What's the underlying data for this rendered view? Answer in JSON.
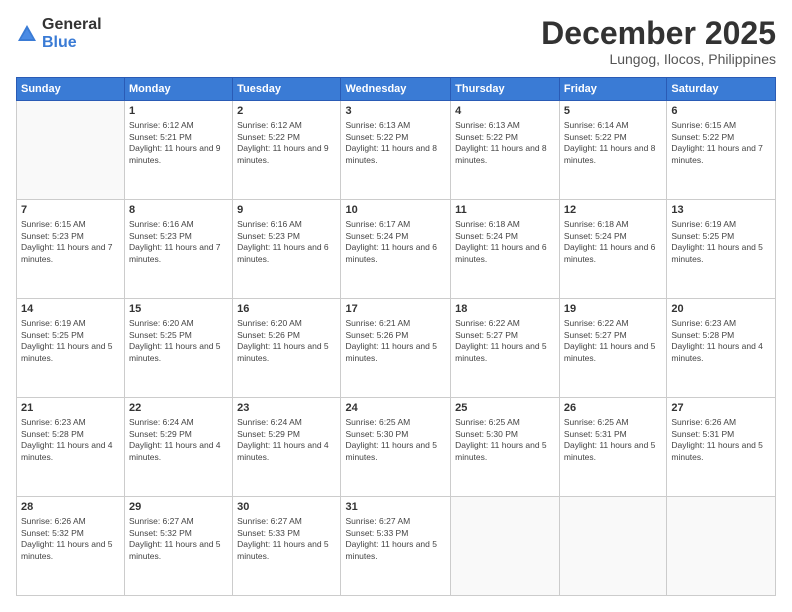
{
  "logo": {
    "general": "General",
    "blue": "Blue"
  },
  "title": "December 2025",
  "location": "Lungog, Ilocos, Philippines",
  "days_header": [
    "Sunday",
    "Monday",
    "Tuesday",
    "Wednesday",
    "Thursday",
    "Friday",
    "Saturday"
  ],
  "weeks": [
    [
      {
        "day": "",
        "sunrise": "",
        "sunset": "",
        "daylight": ""
      },
      {
        "day": "1",
        "sunrise": "Sunrise: 6:12 AM",
        "sunset": "Sunset: 5:21 PM",
        "daylight": "Daylight: 11 hours and 9 minutes."
      },
      {
        "day": "2",
        "sunrise": "Sunrise: 6:12 AM",
        "sunset": "Sunset: 5:22 PM",
        "daylight": "Daylight: 11 hours and 9 minutes."
      },
      {
        "day": "3",
        "sunrise": "Sunrise: 6:13 AM",
        "sunset": "Sunset: 5:22 PM",
        "daylight": "Daylight: 11 hours and 8 minutes."
      },
      {
        "day": "4",
        "sunrise": "Sunrise: 6:13 AM",
        "sunset": "Sunset: 5:22 PM",
        "daylight": "Daylight: 11 hours and 8 minutes."
      },
      {
        "day": "5",
        "sunrise": "Sunrise: 6:14 AM",
        "sunset": "Sunset: 5:22 PM",
        "daylight": "Daylight: 11 hours and 8 minutes."
      },
      {
        "day": "6",
        "sunrise": "Sunrise: 6:15 AM",
        "sunset": "Sunset: 5:22 PM",
        "daylight": "Daylight: 11 hours and 7 minutes."
      }
    ],
    [
      {
        "day": "7",
        "sunrise": "Sunrise: 6:15 AM",
        "sunset": "Sunset: 5:23 PM",
        "daylight": "Daylight: 11 hours and 7 minutes."
      },
      {
        "day": "8",
        "sunrise": "Sunrise: 6:16 AM",
        "sunset": "Sunset: 5:23 PM",
        "daylight": "Daylight: 11 hours and 7 minutes."
      },
      {
        "day": "9",
        "sunrise": "Sunrise: 6:16 AM",
        "sunset": "Sunset: 5:23 PM",
        "daylight": "Daylight: 11 hours and 6 minutes."
      },
      {
        "day": "10",
        "sunrise": "Sunrise: 6:17 AM",
        "sunset": "Sunset: 5:24 PM",
        "daylight": "Daylight: 11 hours and 6 minutes."
      },
      {
        "day": "11",
        "sunrise": "Sunrise: 6:18 AM",
        "sunset": "Sunset: 5:24 PM",
        "daylight": "Daylight: 11 hours and 6 minutes."
      },
      {
        "day": "12",
        "sunrise": "Sunrise: 6:18 AM",
        "sunset": "Sunset: 5:24 PM",
        "daylight": "Daylight: 11 hours and 6 minutes."
      },
      {
        "day": "13",
        "sunrise": "Sunrise: 6:19 AM",
        "sunset": "Sunset: 5:25 PM",
        "daylight": "Daylight: 11 hours and 5 minutes."
      }
    ],
    [
      {
        "day": "14",
        "sunrise": "Sunrise: 6:19 AM",
        "sunset": "Sunset: 5:25 PM",
        "daylight": "Daylight: 11 hours and 5 minutes."
      },
      {
        "day": "15",
        "sunrise": "Sunrise: 6:20 AM",
        "sunset": "Sunset: 5:25 PM",
        "daylight": "Daylight: 11 hours and 5 minutes."
      },
      {
        "day": "16",
        "sunrise": "Sunrise: 6:20 AM",
        "sunset": "Sunset: 5:26 PM",
        "daylight": "Daylight: 11 hours and 5 minutes."
      },
      {
        "day": "17",
        "sunrise": "Sunrise: 6:21 AM",
        "sunset": "Sunset: 5:26 PM",
        "daylight": "Daylight: 11 hours and 5 minutes."
      },
      {
        "day": "18",
        "sunrise": "Sunrise: 6:22 AM",
        "sunset": "Sunset: 5:27 PM",
        "daylight": "Daylight: 11 hours and 5 minutes."
      },
      {
        "day": "19",
        "sunrise": "Sunrise: 6:22 AM",
        "sunset": "Sunset: 5:27 PM",
        "daylight": "Daylight: 11 hours and 5 minutes."
      },
      {
        "day": "20",
        "sunrise": "Sunrise: 6:23 AM",
        "sunset": "Sunset: 5:28 PM",
        "daylight": "Daylight: 11 hours and 4 minutes."
      }
    ],
    [
      {
        "day": "21",
        "sunrise": "Sunrise: 6:23 AM",
        "sunset": "Sunset: 5:28 PM",
        "daylight": "Daylight: 11 hours and 4 minutes."
      },
      {
        "day": "22",
        "sunrise": "Sunrise: 6:24 AM",
        "sunset": "Sunset: 5:29 PM",
        "daylight": "Daylight: 11 hours and 4 minutes."
      },
      {
        "day": "23",
        "sunrise": "Sunrise: 6:24 AM",
        "sunset": "Sunset: 5:29 PM",
        "daylight": "Daylight: 11 hours and 4 minutes."
      },
      {
        "day": "24",
        "sunrise": "Sunrise: 6:25 AM",
        "sunset": "Sunset: 5:30 PM",
        "daylight": "Daylight: 11 hours and 5 minutes."
      },
      {
        "day": "25",
        "sunrise": "Sunrise: 6:25 AM",
        "sunset": "Sunset: 5:30 PM",
        "daylight": "Daylight: 11 hours and 5 minutes."
      },
      {
        "day": "26",
        "sunrise": "Sunrise: 6:25 AM",
        "sunset": "Sunset: 5:31 PM",
        "daylight": "Daylight: 11 hours and 5 minutes."
      },
      {
        "day": "27",
        "sunrise": "Sunrise: 6:26 AM",
        "sunset": "Sunset: 5:31 PM",
        "daylight": "Daylight: 11 hours and 5 minutes."
      }
    ],
    [
      {
        "day": "28",
        "sunrise": "Sunrise: 6:26 AM",
        "sunset": "Sunset: 5:32 PM",
        "daylight": "Daylight: 11 hours and 5 minutes."
      },
      {
        "day": "29",
        "sunrise": "Sunrise: 6:27 AM",
        "sunset": "Sunset: 5:32 PM",
        "daylight": "Daylight: 11 hours and 5 minutes."
      },
      {
        "day": "30",
        "sunrise": "Sunrise: 6:27 AM",
        "sunset": "Sunset: 5:33 PM",
        "daylight": "Daylight: 11 hours and 5 minutes."
      },
      {
        "day": "31",
        "sunrise": "Sunrise: 6:27 AM",
        "sunset": "Sunset: 5:33 PM",
        "daylight": "Daylight: 11 hours and 5 minutes."
      },
      {
        "day": "",
        "sunrise": "",
        "sunset": "",
        "daylight": ""
      },
      {
        "day": "",
        "sunrise": "",
        "sunset": "",
        "daylight": ""
      },
      {
        "day": "",
        "sunrise": "",
        "sunset": "",
        "daylight": ""
      }
    ]
  ]
}
